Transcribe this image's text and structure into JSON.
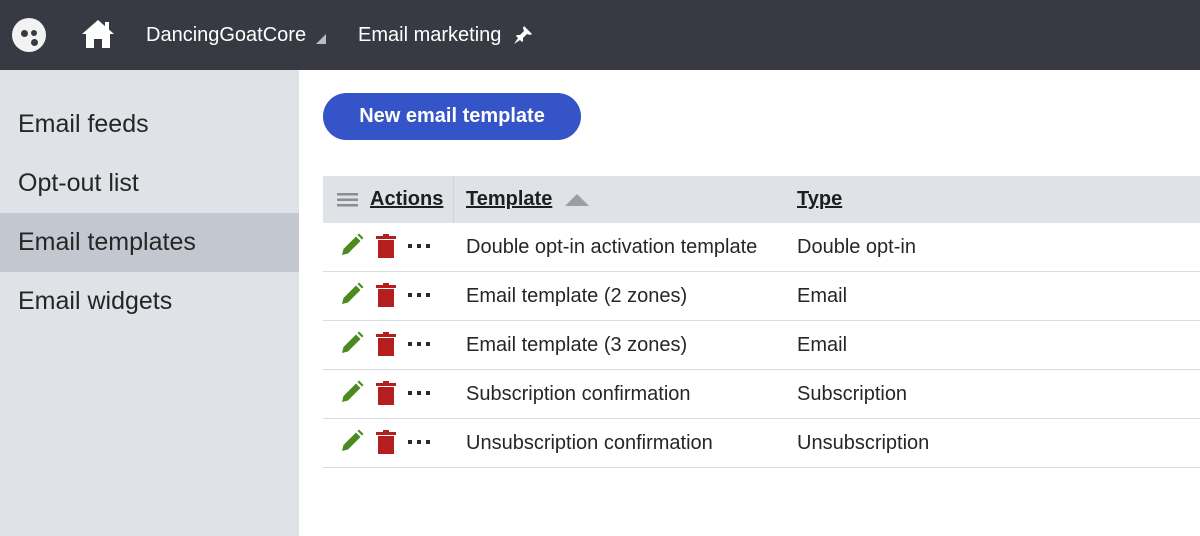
{
  "topbar": {
    "site_name": "DancingGoatCore",
    "app_name": "Email marketing",
    "icons": [
      "app-logo-icon",
      "home-icon",
      "caret-down-icon",
      "pin-icon"
    ]
  },
  "sidebar": {
    "items": [
      {
        "label": "Email feeds"
      },
      {
        "label": "Opt-out list"
      },
      {
        "label": "Email templates"
      },
      {
        "label": "Email widgets"
      }
    ],
    "active_index": 2
  },
  "toolbar": {
    "new_button_label": "New email template"
  },
  "grid": {
    "columns": {
      "actions": "Actions",
      "template": "Template",
      "type": "Type"
    },
    "sort": {
      "column": "Template",
      "direction": "ascending"
    },
    "rows": [
      {
        "template": "Double opt-in activation template",
        "type": "Double opt-in"
      },
      {
        "template": "Email template (2 zones)",
        "type": "Email"
      },
      {
        "template": "Email template (3 zones)",
        "type": "Email"
      },
      {
        "template": "Subscription confirmation",
        "type": "Subscription"
      },
      {
        "template": "Unsubscription confirmation",
        "type": "Unsubscription"
      }
    ]
  },
  "colors": {
    "topbar": "#373a42",
    "sidebar": "#dfe2e7",
    "sidebar_active": "#c3c7d0",
    "primary_button": "#3554c8",
    "edit_icon": "#4a8a1e",
    "delete_icon": "#b41e1e"
  }
}
